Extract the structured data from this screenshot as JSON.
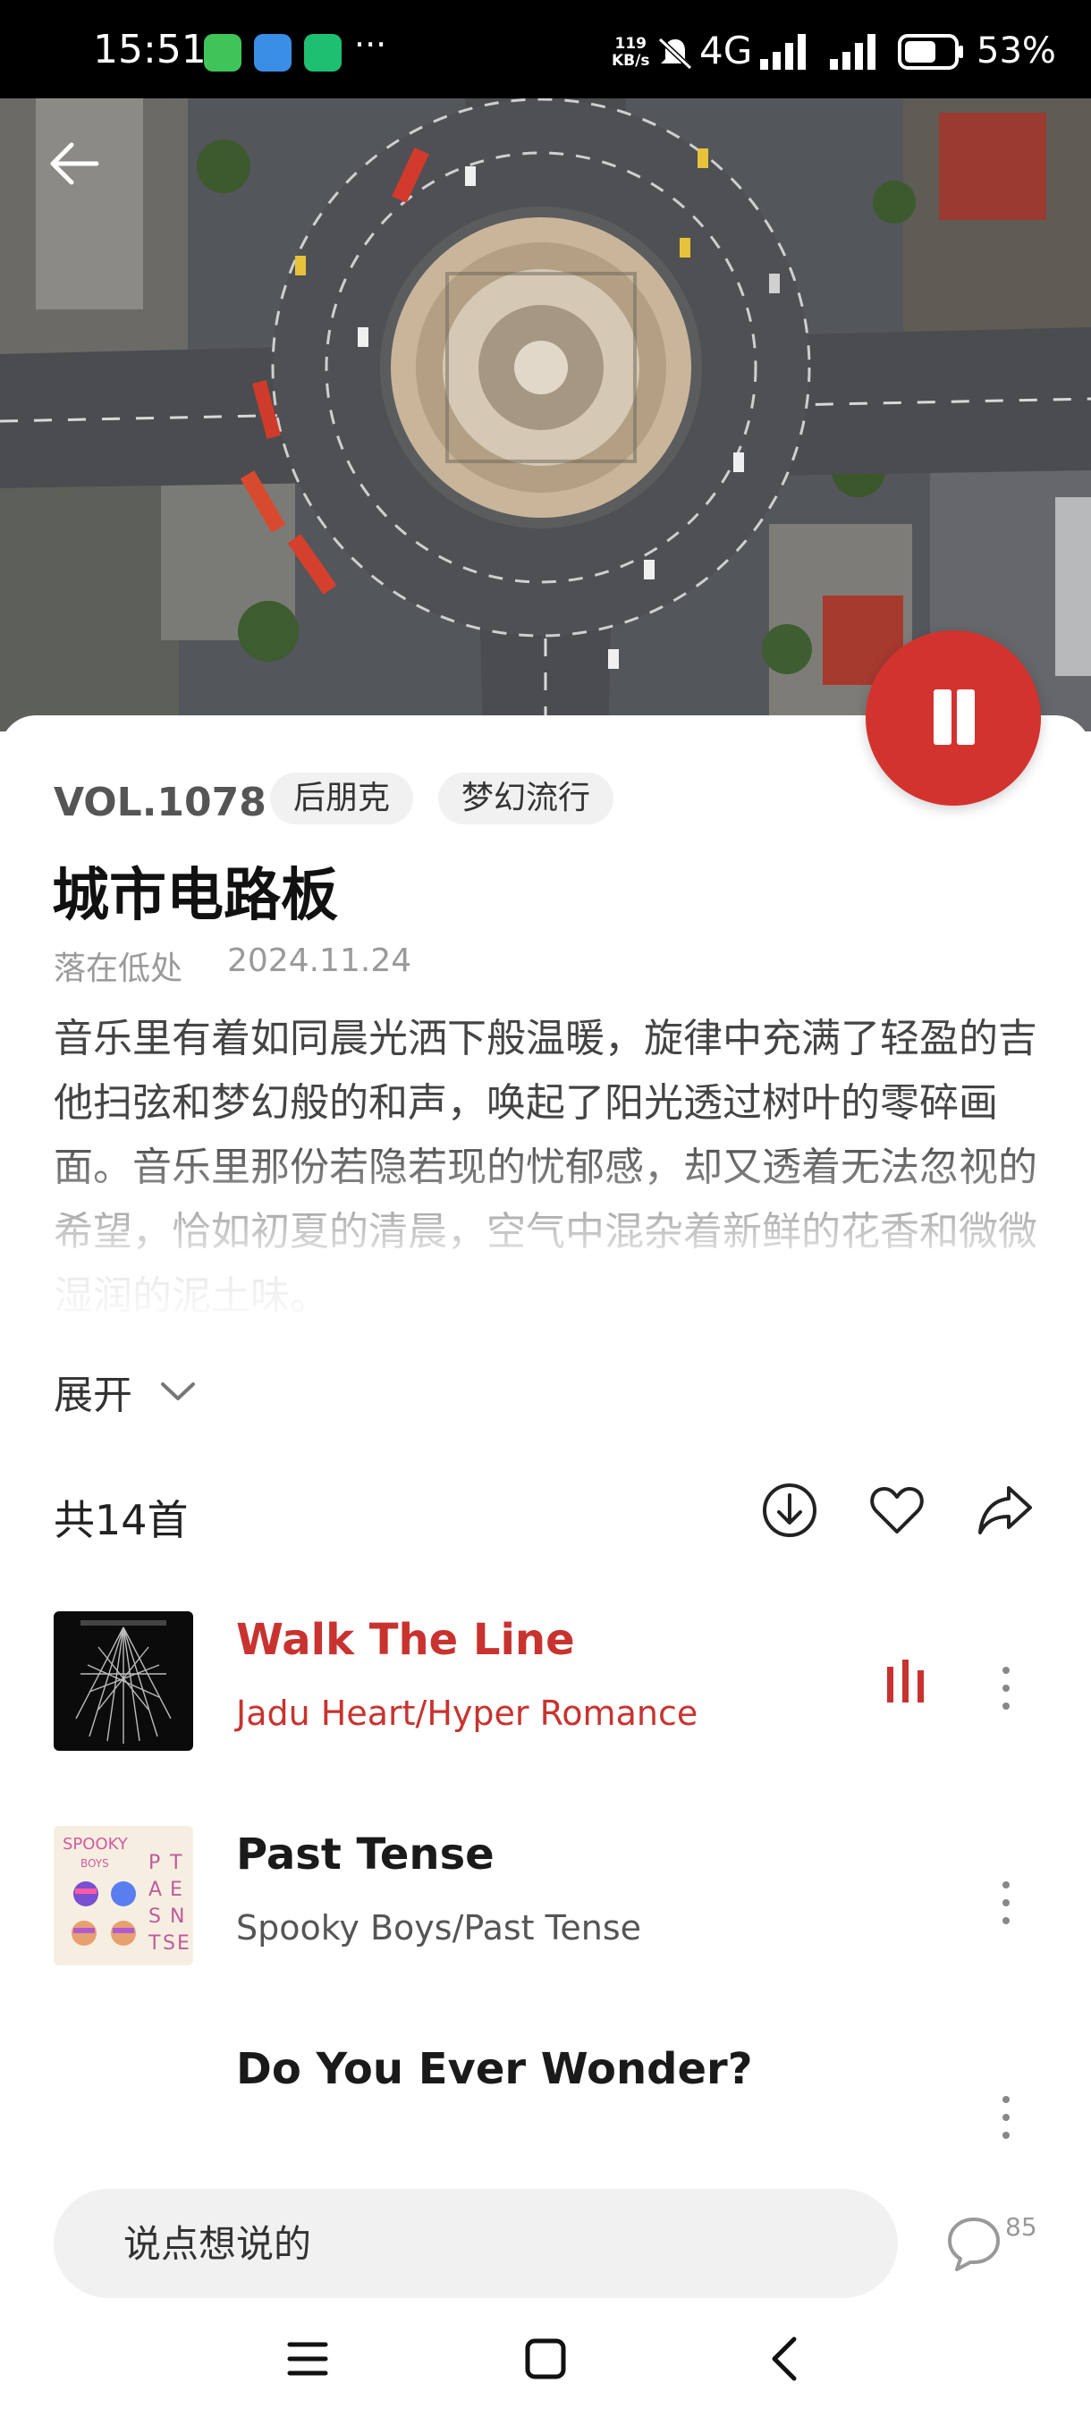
{
  "status_bar": {
    "time": "15:51",
    "more": "···",
    "net_speed_value": "119",
    "net_speed_unit": "KB/s",
    "network": "4G",
    "battery": "53%"
  },
  "album": {
    "vol": "VOL.1078",
    "tags": [
      "后朋克",
      "梦幻流行"
    ],
    "title": "城市电路板",
    "author": "落在低处",
    "date": "2024.11.24",
    "description": "音乐里有着如同晨光洒下般温暖，旋律中充满了轻盈的吉他扫弦和梦幻般的和声，唤起了阳光透过树叶的零碎画面。音乐里那份若隐若现的忧郁感，却又透着无法忽视的希望，恰如初夏的清晨，空气中混杂着新鲜的花香和微微湿润的泥土味。",
    "expand_label": "展开"
  },
  "playlist": {
    "count_label": "共14首",
    "songs": [
      {
        "title": "Walk The Line",
        "artist": "Jadu Heart/Hyper Romance",
        "playing": true
      },
      {
        "title": "Past Tense",
        "artist": "Spooky Boys/Past Tense",
        "playing": false
      },
      {
        "title": "Do You Ever Wonder?",
        "artist": "",
        "playing": false
      }
    ]
  },
  "art_text": {
    "spooky": "SPOOKY",
    "boys": "BOYS",
    "past_tense_letters": [
      "P",
      "T",
      "A",
      "E",
      "S",
      "N",
      "T",
      "S",
      "E"
    ]
  },
  "comment": {
    "placeholder": "说点想说的",
    "count": "85"
  },
  "colors": {
    "accent": "#d3332f",
    "active_text": "#c8332f"
  },
  "icons": {
    "back": "arrow-left-icon",
    "pause": "pause-icon",
    "expand": "chevron-down-icon",
    "download": "download-icon",
    "favorite": "heart-icon",
    "share": "share-icon",
    "playing": "equalizer-icon",
    "more": "more-vertical-icon",
    "comment": "comment-icon",
    "nav_menu": "menu-icon",
    "nav_home": "home-icon",
    "nav_back": "back-icon"
  }
}
